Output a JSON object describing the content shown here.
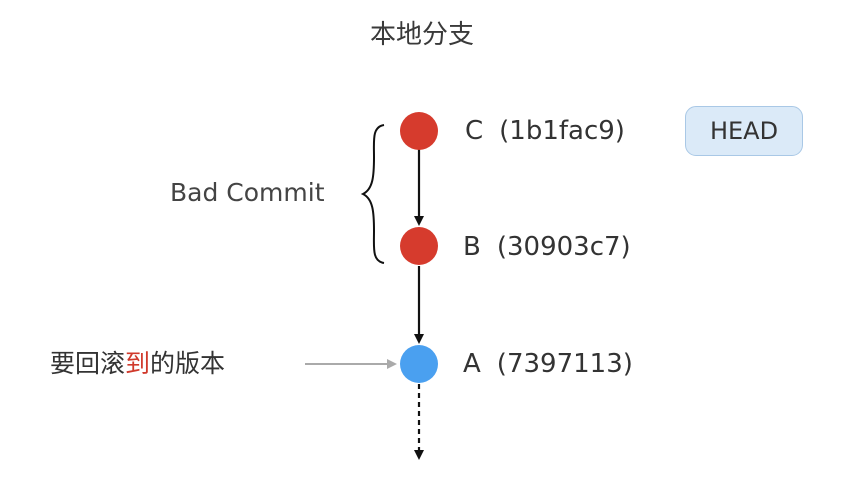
{
  "title": "本地分支",
  "commits": [
    {
      "letter": "C",
      "hash": "(1b1fac9)",
      "color": "#d63b2d"
    },
    {
      "letter": "B",
      "hash": "(30903c7)",
      "color": "#d63b2d"
    },
    {
      "letter": "A",
      "hash": "(7397113)",
      "color": "#4aa0f0"
    }
  ],
  "head_badge": "HEAD",
  "bad_commit_label": "Bad Commit",
  "target_label": {
    "before": "要回滚",
    "highlight": "到",
    "after": "的版本",
    "highlight_color": "#d0392b"
  },
  "colors": {
    "bad_commit": "#d63b2d",
    "good_commit": "#4aa0f0",
    "badge_bg": "#dbeaf8",
    "badge_border": "#a9c8e6",
    "pointer_arrow": "#aaaaaa"
  }
}
